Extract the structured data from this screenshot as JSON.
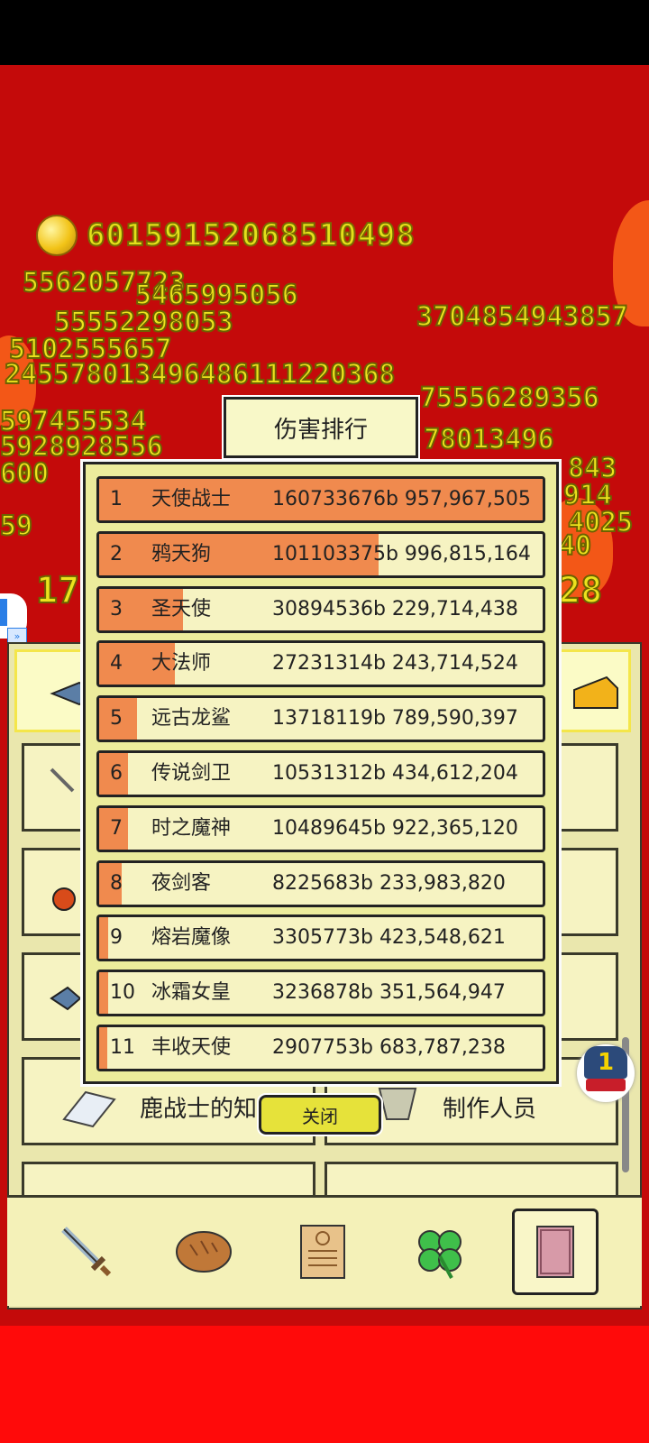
{
  "currency": {
    "value": "60159152068510498"
  },
  "floating_numbers": [
    {
      "text": "5562057723"
    },
    {
      "text": "5465995056"
    },
    {
      "text": "55552298053"
    },
    {
      "text": "5102555657"
    },
    {
      "text": "245578013496486111220368"
    },
    {
      "text": "597455534"
    },
    {
      "text": "5928928556"
    },
    {
      "text": "600"
    },
    {
      "text": "59"
    },
    {
      "text": "17"
    },
    {
      "text": "28"
    },
    {
      "text": "3704854943857"
    },
    {
      "text": "75556289356"
    },
    {
      "text": "78013496"
    },
    {
      "text": "843"
    },
    {
      "text": "914"
    },
    {
      "text": "4025"
    },
    {
      "text": "40"
    }
  ],
  "menu": {
    "knowledge_label": "鹿战士的知识",
    "credits_label": "制作人员"
  },
  "dialog": {
    "title": "伤害排行",
    "close_label": "关闭",
    "rows": [
      {
        "rank": "1",
        "name": "天使战士",
        "value": "160733676b 957,967,505",
        "fill": 1.0
      },
      {
        "rank": "2",
        "name": "鸦天狗",
        "value": "101103375b 996,815,164",
        "fill": 0.63
      },
      {
        "rank": "3",
        "name": "圣天使",
        "value": "30894536b 229,714,438",
        "fill": 0.19
      },
      {
        "rank": "4",
        "name": "大法师",
        "value": "27231314b 243,714,524",
        "fill": 0.17
      },
      {
        "rank": "5",
        "name": "远古龙鲨",
        "value": "13718119b 789,590,397",
        "fill": 0.085
      },
      {
        "rank": "6",
        "name": "传说剑卫",
        "value": "10531312b 434,612,204",
        "fill": 0.066
      },
      {
        "rank": "7",
        "name": "时之魔神",
        "value": "10489645b 922,365,120",
        "fill": 0.065
      },
      {
        "rank": "8",
        "name": "夜剑客",
        "value": "8225683b 233,983,820",
        "fill": 0.051
      },
      {
        "rank": "9",
        "name": "熔岩魔像",
        "value": "3305773b 423,548,621",
        "fill": 0.021
      },
      {
        "rank": "10",
        "name": "冰霜女皇",
        "value": "3236878b 351,564,947",
        "fill": 0.02
      },
      {
        "rank": "11",
        "name": "丰收天使",
        "value": "2907753b 683,787,238",
        "fill": 0.018
      }
    ]
  },
  "badge": {
    "count": "1"
  },
  "nav": [
    {
      "icon": "sword-icon"
    },
    {
      "icon": "bread-icon"
    },
    {
      "icon": "scroll-icon"
    },
    {
      "icon": "clover-icon"
    },
    {
      "icon": "book-icon"
    }
  ],
  "colors": {
    "rank_fill": "#f08a4e",
    "panel": "#eae7ad",
    "background": "#c40a0a"
  }
}
